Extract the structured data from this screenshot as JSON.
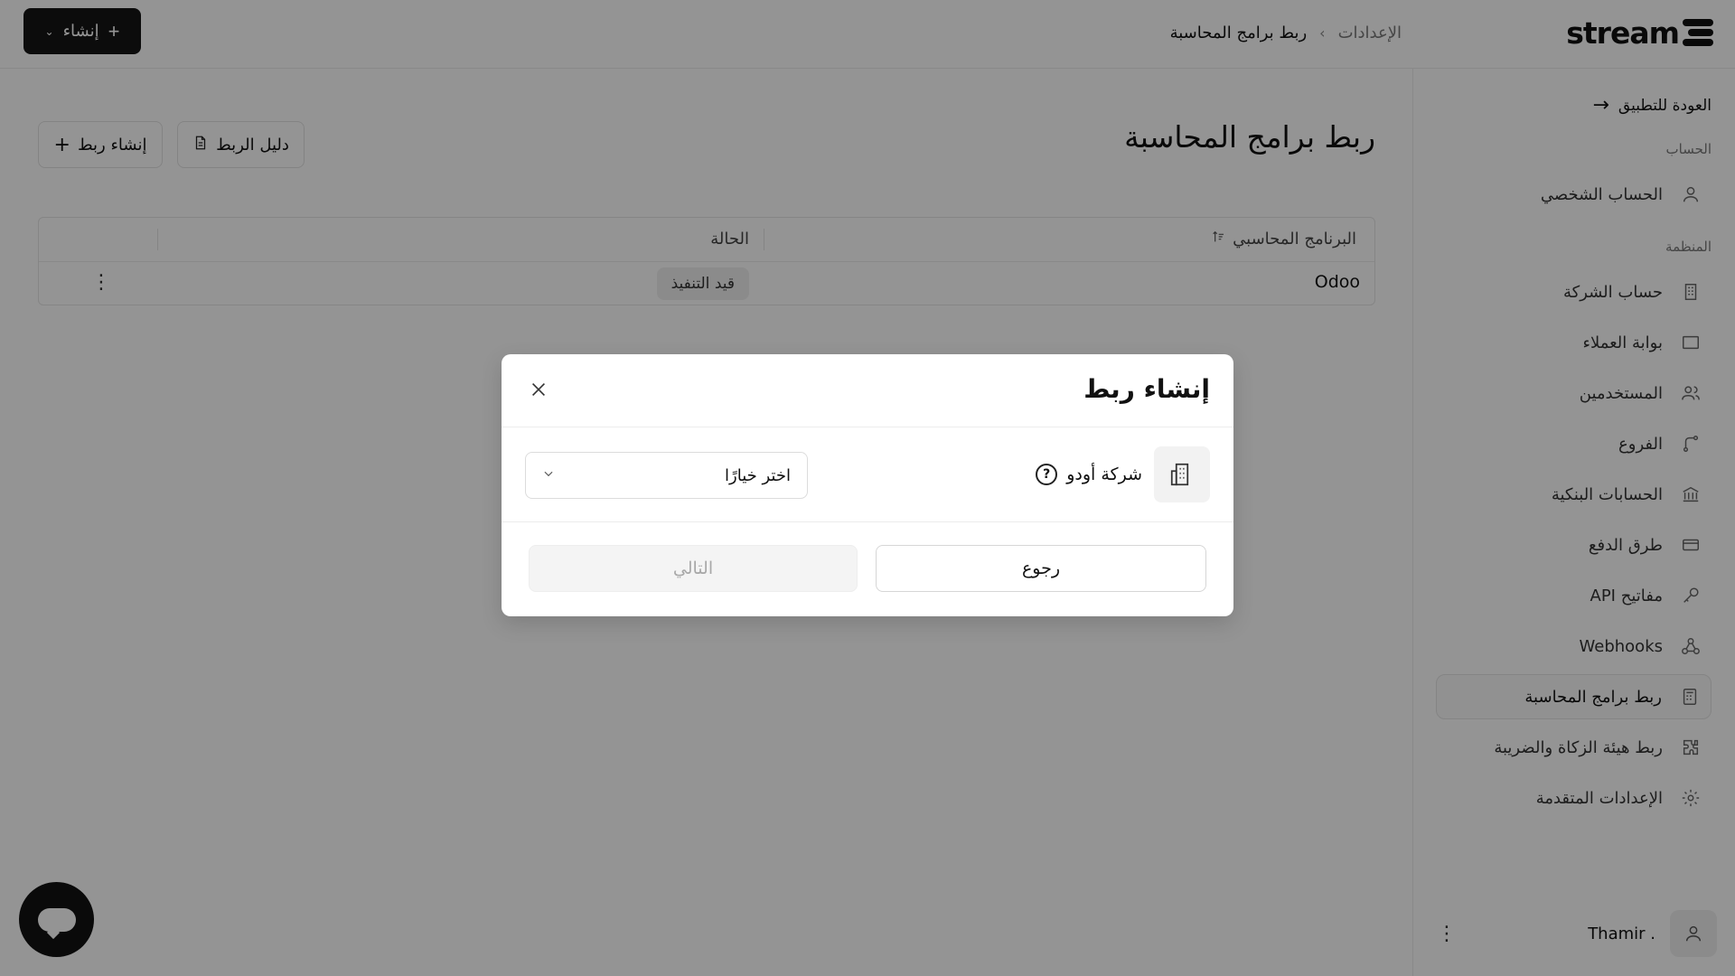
{
  "topbar": {
    "logo_text": "stream",
    "breadcrumb": {
      "parent": "الإعدادات",
      "separator": "›",
      "current": "ربط برامج المحاسبة"
    },
    "create_button": {
      "label": "إنشاء",
      "plus": "+",
      "chevron": "⌄"
    }
  },
  "sidebar": {
    "back_link": "العودة للتطبيق",
    "section_account": "الحساب",
    "section_org": "المنظمة",
    "items": [
      {
        "label": "الحساب الشخصي",
        "icon": "user-icon"
      },
      {
        "label": "حساب الشركة",
        "icon": "building-icon"
      },
      {
        "label": "بوابة العملاء",
        "icon": "portal-icon"
      },
      {
        "label": "المستخدمين",
        "icon": "users-icon"
      },
      {
        "label": "الفروع",
        "icon": "branch-icon"
      },
      {
        "label": "الحسابات البنكية",
        "icon": "bank-icon"
      },
      {
        "label": "طرق الدفع",
        "icon": "card-icon"
      },
      {
        "label": "مفاتيح API",
        "icon": "key-icon"
      },
      {
        "label": "Webhooks",
        "icon": "webhook-icon"
      },
      {
        "label": "ربط برامج المحاسبة",
        "icon": "calculator-icon",
        "active": true
      },
      {
        "label": "ربط هيئة الزكاة والضريبة",
        "icon": "puzzle-icon"
      },
      {
        "label": "الإعدادات المتقدمة",
        "icon": "gear-icon"
      }
    ],
    "user": {
      "name": "Thamir .",
      "menu": "⋮"
    }
  },
  "main": {
    "title": "ربط برامج المحاسبة",
    "guide_button": "دليل الربط",
    "create_link_button": "إنشاء ربط",
    "table": {
      "headers": {
        "program": "البرنامج المحاسبي",
        "status": "الحالة"
      },
      "rows": [
        {
          "program": "Odoo",
          "status": "قيد التنفيذ",
          "menu": "⋮"
        }
      ]
    }
  },
  "modal": {
    "title": "إنشاء ربط",
    "company_name": "شركة أودو",
    "help": "?",
    "select_placeholder": "اختر خيارًا",
    "back_button": "رجوع",
    "next_button": "التالي"
  },
  "colors": {
    "primary_dark": "#161616",
    "overlay": "rgba(0,0,0,0.42)",
    "muted_text": "#777777"
  }
}
